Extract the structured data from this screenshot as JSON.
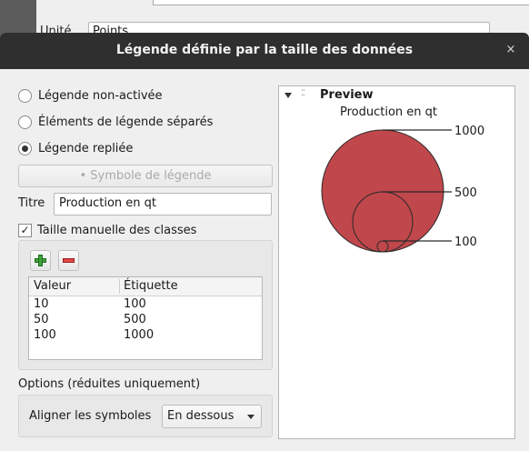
{
  "background": {
    "unite_label": "Unité",
    "unite_value": "Points"
  },
  "dialog": {
    "title": "Légende définie par la taille des données",
    "close_glyph": "×",
    "radios": [
      {
        "label": "Légende non-activée",
        "selected": false
      },
      {
        "label": "Éléments de légende séparés",
        "selected": false
      },
      {
        "label": "Légende repliée",
        "selected": true
      }
    ],
    "symbol_button": "• Symbole de légende",
    "titre_label": "Titre",
    "titre_value": "Production en qt",
    "manual_classes": {
      "label": "Taille manuelle des classes",
      "checked": true
    },
    "toolbar": {
      "add_icon": "add-icon",
      "remove_icon": "remove-icon"
    },
    "table": {
      "headers": [
        "Valeur",
        "Étiquette"
      ],
      "rows": [
        [
          "10",
          "100"
        ],
        [
          "50",
          "500"
        ],
        [
          "100",
          "1000"
        ]
      ]
    },
    "options_label": "Options (réduites uniquement)",
    "align_label": "Aligner les symboles",
    "align_value": "En dessous",
    "preview": {
      "header": "Preview",
      "subtitle": "Production en qt",
      "labels": [
        "1000",
        "500",
        "100"
      ],
      "circle_color": "#c0474b"
    }
  }
}
